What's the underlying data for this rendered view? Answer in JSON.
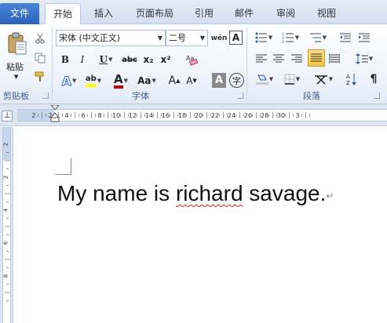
{
  "tabs": {
    "file": "文件",
    "items": [
      "开始",
      "插入",
      "页面布局",
      "引用",
      "邮件",
      "审阅",
      "视图"
    ],
    "active": "开始"
  },
  "clipboard": {
    "paste_label": "粘贴",
    "group_label": "剪贴板",
    "icons": [
      "cut-icon",
      "copy-icon",
      "format-painter-icon"
    ]
  },
  "font": {
    "group_label": "字体",
    "font_name": "宋体 (中文正文)",
    "font_size": "二号",
    "wen_label": "wén",
    "char_border": "A",
    "bold": "B",
    "italic": "I",
    "underline": "U",
    "strikethrough": "abc",
    "subscript": "x₂",
    "superscript": "x²",
    "clear_format_icon": "clear-format-icon",
    "text_effect": "A",
    "highlight": "ab",
    "font_color": "A",
    "change_case": "Aa",
    "grow_font": "A",
    "shrink_font": "A",
    "char_shading": "A",
    "enclose_char": "字",
    "highlight_color": "#ffff00",
    "font_color_value": "#c00000"
  },
  "paragraph": {
    "group_label": "段落",
    "icons": [
      "bullets-icon",
      "numbering-icon",
      "multilevel-list-icon",
      "decrease-indent-icon",
      "increase-indent-icon",
      "align-left-icon",
      "center-icon",
      "align-right-icon",
      "justify-icon",
      "distributed-icon",
      "line-spacing-icon",
      "shading-icon",
      "borders-icon",
      "asian-layout-icon",
      "sort-icon"
    ]
  },
  "ruler": {
    "tab_selector": "⊥",
    "h_labels": [
      "2",
      "2",
      "4",
      "6",
      "8",
      "10",
      "12",
      "14",
      "16",
      "18",
      "20",
      "22",
      "24",
      "26",
      "28",
      "30",
      "3"
    ],
    "v_labels": [
      "2",
      "2",
      "4",
      "6",
      "8"
    ]
  },
  "document": {
    "before": "My name is ",
    "misspelled": "richard",
    "after": " savage.",
    "pilcrow": "↵"
  },
  "colors": {
    "accent": "#2a62b8",
    "spell_error": "#e02020"
  }
}
